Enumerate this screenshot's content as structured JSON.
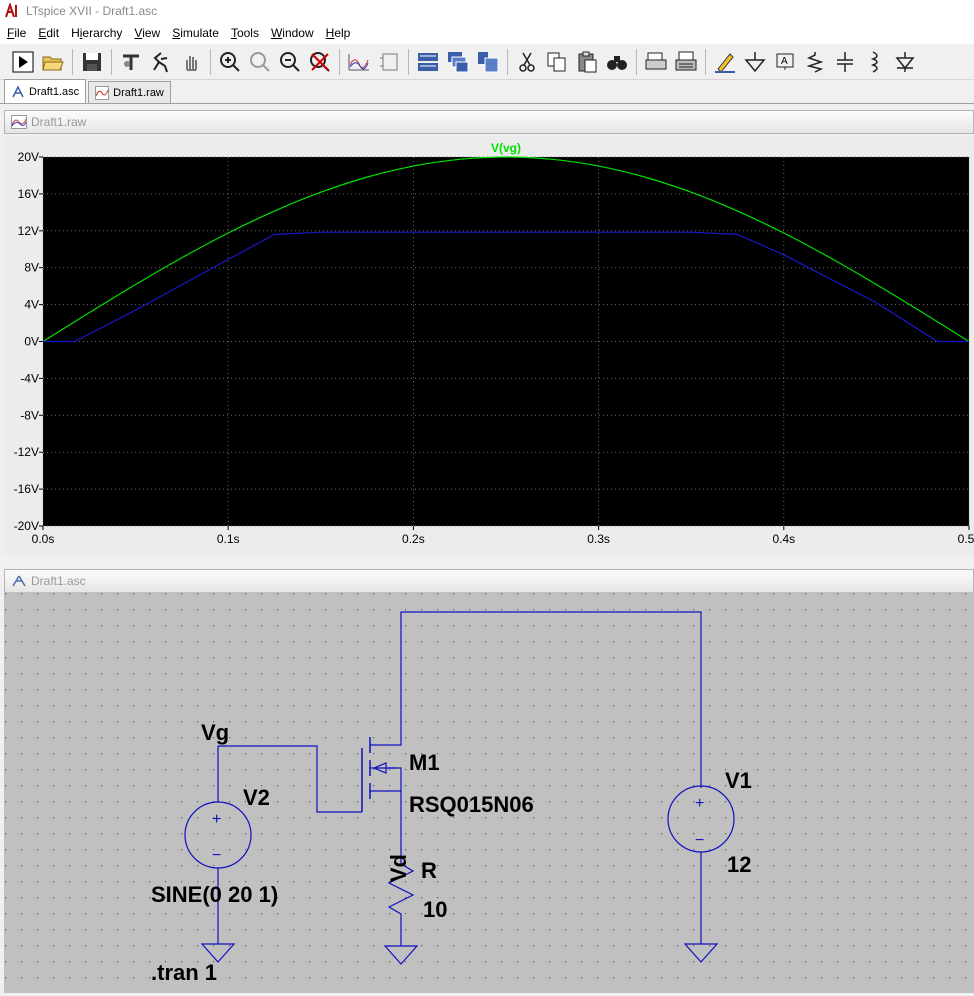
{
  "window": {
    "title": "LTspice XVII - Draft1.asc"
  },
  "menu": [
    {
      "pre": "",
      "u": "F",
      "post": "ile"
    },
    {
      "pre": "",
      "u": "E",
      "post": "dit"
    },
    {
      "pre": "H",
      "u": "i",
      "post": "erarchy"
    },
    {
      "pre": "",
      "u": "V",
      "post": "iew"
    },
    {
      "pre": "",
      "u": "S",
      "post": "imulate"
    },
    {
      "pre": "",
      "u": "T",
      "post": "ools"
    },
    {
      "pre": "",
      "u": "W",
      "post": "indow"
    },
    {
      "pre": "",
      "u": "H",
      "post": "elp"
    }
  ],
  "toolbar_icons": [
    "run-icon",
    "open-icon",
    "|",
    "save-icon",
    "|",
    "control-panel-icon",
    "halt-icon",
    "pan-icon",
    "|",
    "zoom-in-icon",
    "zoom-fit-icon",
    "zoom-out-icon",
    "zoom-cancel-icon",
    "|",
    "autorange-icon",
    "schematic-icon",
    "|",
    "tile-horizontal-icon",
    "cascade-icon",
    "tile-vertical-icon",
    "|",
    "cut-icon",
    "copy-icon",
    "paste-icon",
    "find-icon",
    "|",
    "print-preview-icon",
    "print-icon",
    "|",
    "draw-wire-icon",
    "ground-icon",
    "label-net-icon",
    "resistor-icon",
    "capacitor-icon",
    "inductor-icon",
    "diode-icon"
  ],
  "tabs": [
    {
      "label": "Draft1.asc",
      "icon": "schematic-tab-icon",
      "active": true
    },
    {
      "label": "Draft1.raw",
      "icon": "waveform-tab-icon",
      "active": false
    }
  ],
  "plot_window": {
    "title": "Draft1.raw"
  },
  "schematic_window": {
    "title": "Draft1.asc"
  },
  "chart_data": {
    "type": "line",
    "background": "#000000",
    "grid": true,
    "ylim": [
      -20,
      20
    ],
    "yticks": [
      20,
      16,
      12,
      8,
      4,
      0,
      -4,
      -8,
      -12,
      -16,
      -20
    ],
    "ytick_labels": [
      "20V",
      "16V",
      "12V",
      "8V",
      "4V",
      "0V",
      "-4V",
      "-8V",
      "-12V",
      "-16V",
      "-20V"
    ],
    "xlim": [
      0,
      0.5
    ],
    "xticks": [
      0,
      0.1,
      0.2,
      0.3,
      0.4,
      0.5
    ],
    "xtick_labels": [
      "0.0s",
      "0.1s",
      "0.2s",
      "0.3s",
      "0.4s",
      "0.5s"
    ],
    "series": [
      {
        "name": "V(vg)",
        "color": "#00e000",
        "x": [
          0,
          0.025,
          0.05,
          0.075,
          0.1,
          0.125,
          0.15,
          0.175,
          0.2,
          0.225,
          0.25,
          0.275,
          0.3,
          0.325,
          0.35,
          0.375,
          0.4,
          0.425,
          0.45,
          0.475,
          0.5
        ],
        "y": [
          0,
          3.13,
          6.18,
          9.08,
          11.76,
          14.14,
          16.18,
          17.82,
          19.02,
          19.75,
          20,
          19.75,
          19.02,
          17.82,
          16.18,
          14.14,
          11.76,
          9.08,
          6.18,
          3.13,
          0
        ]
      },
      {
        "name": "",
        "color": "#1818c8",
        "x": [
          0,
          0.017,
          0.05,
          0.1,
          0.125,
          0.15,
          0.2,
          0.25,
          0.3,
          0.35,
          0.375,
          0.4,
          0.45,
          0.483,
          0.5
        ],
        "y": [
          0,
          0,
          3.4,
          8.9,
          11.6,
          11.85,
          11.85,
          11.85,
          11.85,
          11.85,
          11.6,
          9.4,
          4.2,
          0,
          0
        ]
      }
    ]
  },
  "schematic": {
    "wire_color": "#1010c0",
    "net_label": "Vg",
    "net_label_vd": "Vd",
    "v2": {
      "name": "V2",
      "value": "SINE(0 20 1)"
    },
    "m1": {
      "name": "M1",
      "model": "RSQ015N06"
    },
    "r": {
      "name": "R",
      "value": "10"
    },
    "v1": {
      "name": "V1",
      "value": "12"
    },
    "directive": ".tran 1",
    "plus": "+",
    "minus": "−"
  }
}
